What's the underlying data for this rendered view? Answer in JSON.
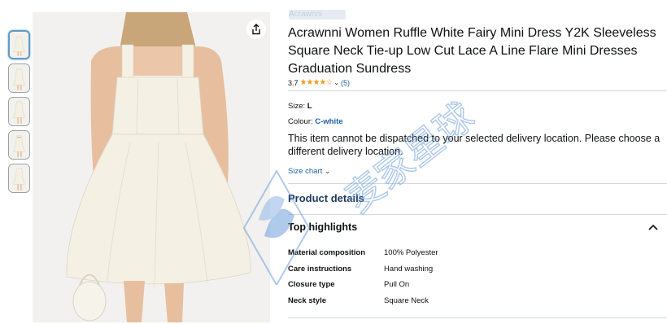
{
  "brand": {
    "label": "Acrawnni"
  },
  "product": {
    "title": "Acrawnni Women Ruffle White Fairy Mini Dress Y2K Sleeveless Square Neck Tie-up Low Cut Lace A Line Flare Mini Dresses Graduation Sundress",
    "rating_value": "3.7",
    "rating_fraction": 0.74,
    "rating_count": "(5)",
    "size_label": "Size:",
    "size_value": "L",
    "colour_label": "Colour:",
    "colour_value": "C-white",
    "dispatch_message": "This item cannot be dispatched to your selected delivery location. Please choose a different delivery location.",
    "size_chart": "Size chart"
  },
  "details": {
    "section_title": "Product details",
    "highlights_title": "Top highlights",
    "specs": [
      {
        "key": "Material composition",
        "value": "100% Polyester"
      },
      {
        "key": "Care instructions",
        "value": "Hand washing"
      },
      {
        "key": "Closure type",
        "value": "Pull On"
      },
      {
        "key": "Neck style",
        "value": "Square Neck"
      }
    ]
  },
  "gallery": {
    "thumbnail_count": 5,
    "selected_index": 0
  },
  "colors": {
    "link": "#2162a1",
    "star": "#f19c1c",
    "text": "#0f1111",
    "divider": "#d5d9d9",
    "dress": "#f4f0e4",
    "watermark": "#6fa0dc"
  },
  "icons": {
    "share": "share-icon",
    "caret_up": "chevron-up-icon",
    "caret_down": "chevron-down-icon",
    "stars": "star-rating-icon"
  },
  "watermark": {
    "text": "麦家星球"
  }
}
